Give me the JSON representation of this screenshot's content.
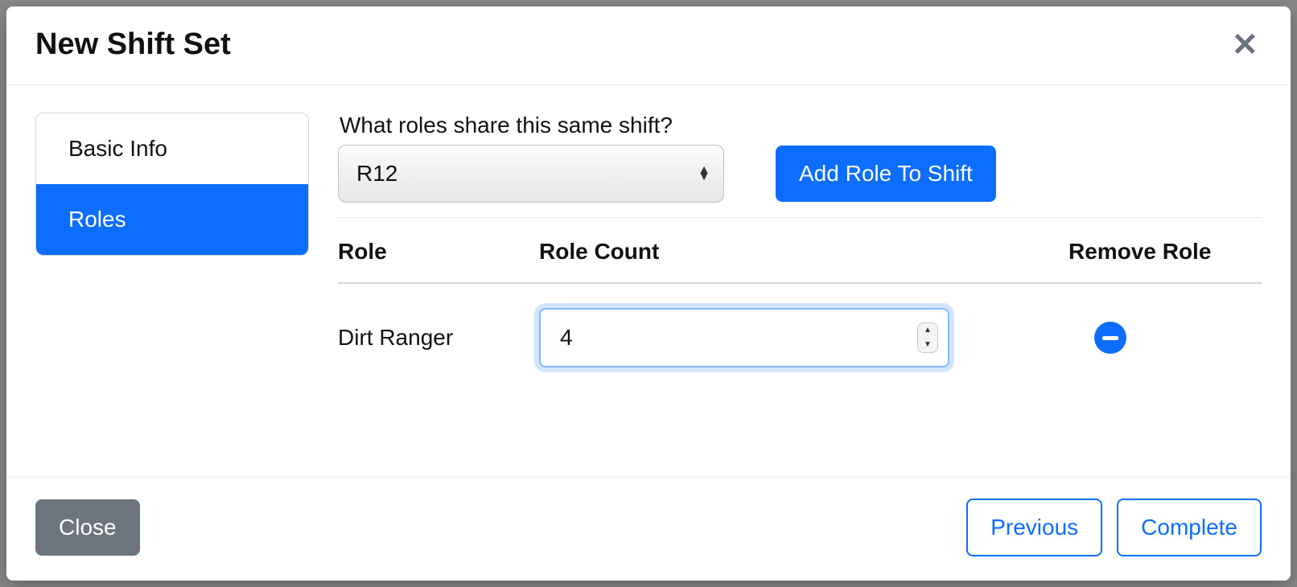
{
  "modal": {
    "title": "New Shift Set"
  },
  "tabs": {
    "basic_info": "Basic Info",
    "roles": "Roles"
  },
  "main": {
    "prompt": "What roles share this same shift?",
    "selected_role": "R12",
    "add_button": "Add Role To Shift"
  },
  "table": {
    "headers": {
      "role": "Role",
      "count": "Role Count",
      "remove": "Remove Role"
    },
    "rows": [
      {
        "role": "Dirt Ranger",
        "count": "4"
      }
    ]
  },
  "footer": {
    "close": "Close",
    "previous": "Previous",
    "complete": "Complete"
  }
}
